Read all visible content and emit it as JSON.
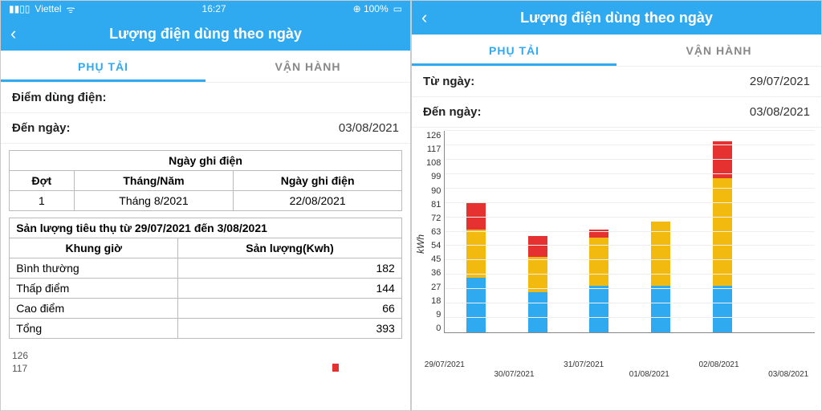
{
  "statusbar": {
    "carrier": "Viettel",
    "time": "16:27",
    "battery": "100%"
  },
  "header": {
    "title": "Lượng điện dùng theo ngày"
  },
  "tabs": {
    "load": "PHỤ TẢI",
    "operate": "VẬN HÀNH"
  },
  "left": {
    "point_label": "Điểm dùng điện:",
    "to_label": "Đến ngày:",
    "to_date": "03/08/2021",
    "reading_header": "Ngày ghi điện",
    "col_batch": "Đợt",
    "col_month": "Tháng/Năm",
    "col_date": "Ngày ghi điện",
    "batch": "1",
    "month": "Tháng 8/2021",
    "reading_date": "22/08/2021",
    "consumption_header": "Sản lượng tiêu thụ từ 29/07/2021 đến 3/08/2021",
    "col_slot": "Khung giờ",
    "col_kwh": "Sản lượng(Kwh)",
    "rows": [
      {
        "slot": "Bình thường",
        "kwh": "182"
      },
      {
        "slot": "Thấp điểm",
        "kwh": "144"
      },
      {
        "slot": "Cao điểm",
        "kwh": "66"
      },
      {
        "slot": "Tổng",
        "kwh": "393"
      }
    ],
    "mini_y1": "126",
    "mini_y2": "117"
  },
  "right": {
    "from_label": "Từ ngày:",
    "from_date": "29/07/2021",
    "to_label": "Đến ngày:",
    "to_date": "03/08/2021"
  },
  "chart_data": {
    "type": "bar",
    "stacked": true,
    "title": "",
    "xlabel": "",
    "ylabel": "kWh",
    "ylim": [
      0,
      126
    ],
    "yticks": [
      0,
      9,
      18,
      27,
      36,
      45,
      54,
      63,
      72,
      81,
      90,
      99,
      108,
      117,
      126
    ],
    "categories": [
      "29/07/2021",
      "30/07/2021",
      "31/07/2021",
      "01/08/2021",
      "02/08/2021",
      "03/08/2021"
    ],
    "series": [
      {
        "name": "Bình thường",
        "color": "#2fa9f0",
        "values": [
          34,
          25,
          29,
          29,
          29,
          0
        ]
      },
      {
        "name": "Thấp điểm",
        "color": "#f2b90f",
        "values": [
          30,
          22,
          30,
          40,
          67,
          0
        ]
      },
      {
        "name": "Cao điểm",
        "color": "#e63131",
        "values": [
          17,
          13,
          5,
          0,
          23,
          0
        ]
      }
    ]
  }
}
